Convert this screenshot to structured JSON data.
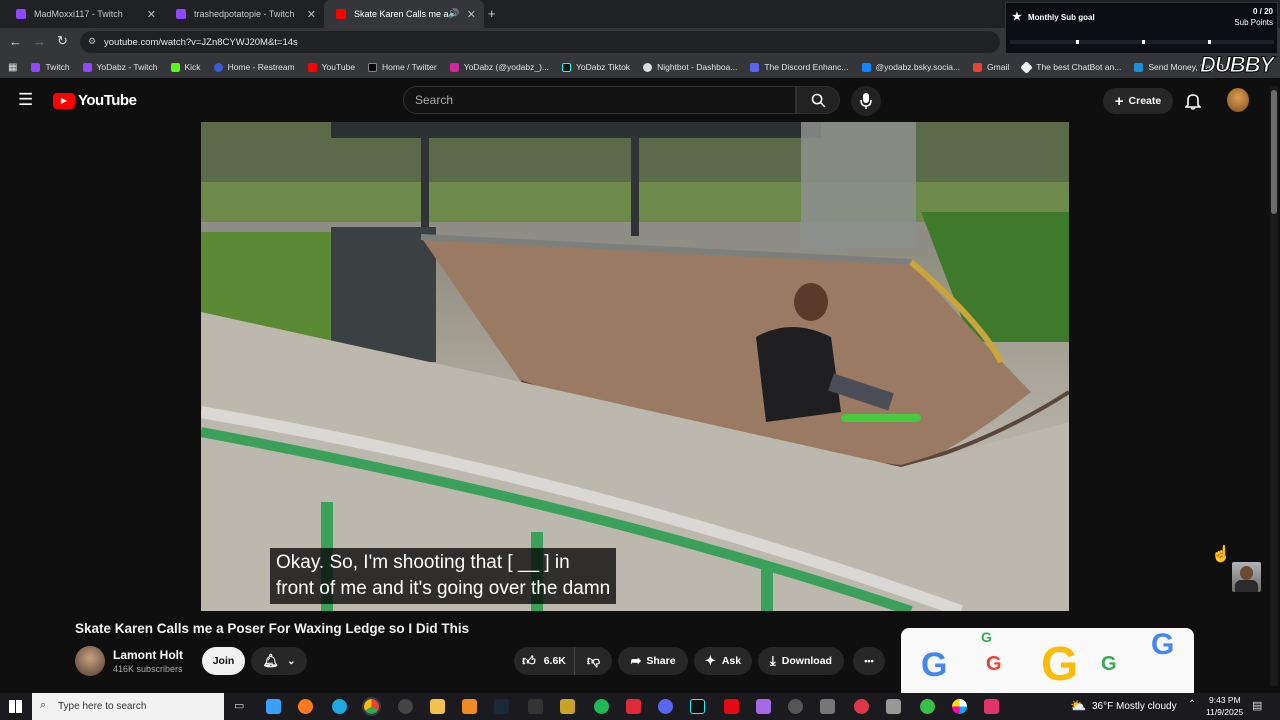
{
  "browser": {
    "tabs": [
      {
        "label": "MadMoxxi117 - Twitch",
        "active": false
      },
      {
        "label": "trashedpotatopie - Twitch",
        "active": false
      },
      {
        "label": "Skate Karen Calls me a Pose",
        "active": true
      }
    ],
    "new_tab": "+",
    "url": "youtube.com/watch?v=JZn8CYWJ20M&t=14s",
    "bookmarks": [
      "Twitch",
      "YoDabz - Twitch",
      "Kick",
      "Home - Restream",
      "YouTube",
      "Home / Twitter",
      "YoDabz (@yodabz_)...",
      "YoDabz Tiktok",
      "Nightbot - Dashboa...",
      "The Discord Enhanc...",
      "@yodabz.bsky.socia...",
      "Gmail",
      "The best ChatBot an...",
      "Send Money, Pay O..."
    ],
    "bookmarks_more": "»"
  },
  "overlay": {
    "goal_title": "Monthly Sub goal",
    "goal_count": "0 / 20",
    "goal_unit": "Sub Points",
    "goal_progress": 0,
    "brand": "DUBBY"
  },
  "youtube": {
    "logo_text": "YouTube",
    "search_placeholder": "Search",
    "create_label": "Create",
    "caption_line1": "Okay. So, I'm shooting that [ __ ] in",
    "caption_line2": "front of me and it's going over the damn",
    "video_title": "Skate Karen Calls me a Poser For Waxing Ledge so I Did This",
    "channel_name": "Lamont Holt",
    "subscribers": "416K subscribers",
    "join_label": "Join",
    "like_count": "6.6K",
    "share_label": "Share",
    "ask_label": "Ask",
    "download_label": "Download",
    "more_label": "•••"
  },
  "taskbar": {
    "search_placeholder": "Type here to search",
    "weather_temp": "36°F",
    "weather_desc": "Mostly cloudy",
    "time": "9:43 PM",
    "date": "11/9/2025"
  },
  "colors": {
    "youtube_red": "#ff0000",
    "twitch_purple": "#9146ff",
    "chrome_dark": "#202124",
    "chrome_mid": "#35363a"
  }
}
